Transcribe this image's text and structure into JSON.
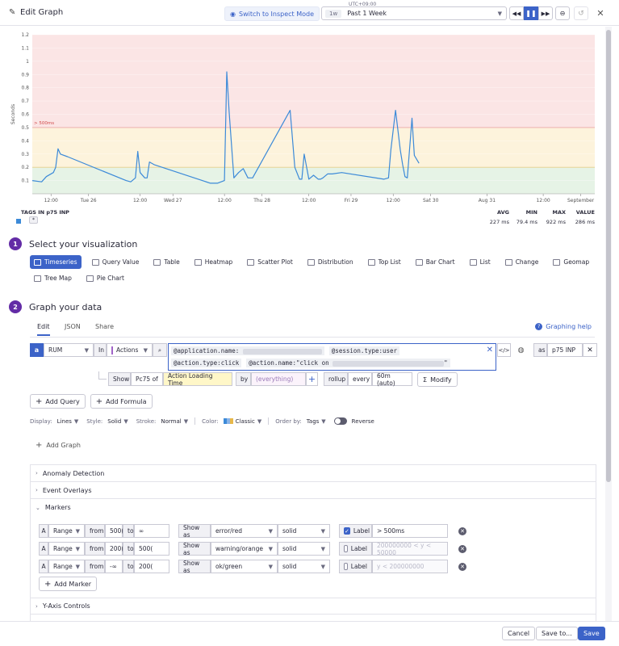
{
  "header": {
    "title": "Edit Graph",
    "inspect_label": "Switch to Inspect Mode",
    "timezone": "UTC+09:00",
    "time_short": "1w",
    "time_label": "Past 1 Week"
  },
  "chart_data": {
    "type": "line",
    "ylabel": "Seconds",
    "ylim": [
      0,
      1.2
    ],
    "y_ticks": [
      "1.2",
      "1.1",
      "1",
      "0.9",
      "0.8",
      "0.7",
      "0.6",
      "0.5",
      "0.4",
      "0.3",
      "0.2",
      "0.1"
    ],
    "x_ticks": [
      "12:00",
      "Tue 26",
      "12:00",
      "Wed 27",
      "12:00",
      "Thu 28",
      "12:00",
      "Fri 29",
      "12:00",
      "Sat 30",
      "Aug 31",
      "12:00",
      "September"
    ],
    "x_tick_pos": [
      0.04,
      0.12,
      0.23,
      0.3,
      0.41,
      0.49,
      0.59,
      0.68,
      0.77,
      0.85,
      0.97,
      1.09,
      1.17
    ],
    "marker_label": "> 500ms",
    "series": [
      {
        "x": [
          0,
          0.02,
          0.03,
          0.045,
          0.05,
          0.055,
          0.06,
          0.075,
          0.2,
          0.21,
          0.22,
          0.225,
          0.23,
          0.24,
          0.245,
          0.25,
          0.26,
          0.38,
          0.395,
          0.41,
          0.415,
          0.42,
          0.43,
          0.44,
          0.45,
          0.46,
          0.47,
          0.55,
          0.56,
          0.57,
          0.575,
          0.58,
          0.59,
          0.6,
          0.61,
          0.615,
          0.62,
          0.63,
          0.64,
          0.66,
          0.75,
          0.76,
          0.765,
          0.775,
          0.785,
          0.79,
          0.795,
          0.8,
          0.81,
          0.815,
          0.825
        ],
        "y": [
          0.1,
          0.09,
          0.13,
          0.16,
          0.2,
          0.34,
          0.3,
          0.28,
          0.1,
          0.09,
          0.12,
          0.32,
          0.16,
          0.12,
          0.12,
          0.24,
          0.22,
          0.08,
          0.08,
          0.1,
          0.92,
          0.62,
          0.12,
          0.16,
          0.19,
          0.12,
          0.12,
          0.63,
          0.2,
          0.11,
          0.11,
          0.3,
          0.11,
          0.14,
          0.11,
          0.11,
          0.12,
          0.15,
          0.15,
          0.16,
          0.11,
          0.12,
          0.33,
          0.63,
          0.33,
          0.22,
          0.13,
          0.12,
          0.57,
          0.29,
          0.23
        ]
      }
    ]
  },
  "legend": {
    "header": "TAGS IN p75 INP",
    "tag": "*",
    "cols": [
      "AVG",
      "MIN",
      "MAX",
      "VALUE"
    ],
    "values": [
      "227 ms",
      "79.4 ms",
      "922 ms",
      "286 ms"
    ]
  },
  "step1": {
    "num": "1",
    "title": "Select your visualization",
    "items": [
      "Timeseries",
      "Query Value",
      "Table",
      "Heatmap",
      "Scatter Plot",
      "Distribution",
      "Top List",
      "Bar Chart",
      "List",
      "Change",
      "Geomap",
      "Tree Map",
      "Pie Chart"
    ]
  },
  "step2": {
    "num": "2",
    "title": "Graph your data",
    "tabs": [
      "Edit",
      "JSON",
      "Share"
    ],
    "help": "Graphing help"
  },
  "query": {
    "letter": "a",
    "source": "RUM",
    "in": "In",
    "dataset": "Actions",
    "filter1a": "@application.name:",
    "filter1b": "@session.type:user",
    "filter2a": "@action.type:click",
    "filter2b": "@action.name:\"click on",
    "as": "as",
    "alias": "p75 INP",
    "show": "Show",
    "agg": "Pc75 of",
    "measure": "Action Loading Time",
    "by": "by",
    "everything": "(everything)",
    "rollup": "rollup",
    "rollup_fn": "every",
    "interval": "60m (auto)",
    "modify": "Modify"
  },
  "actions": {
    "add_query": "Add Query",
    "add_formula": "Add Formula",
    "add_graph": "Add Graph"
  },
  "display": {
    "display_label": "Display:",
    "display_val": "Lines",
    "style_label": "Style:",
    "style_val": "Solid",
    "stroke_label": "Stroke:",
    "stroke_val": "Normal",
    "color_label": "Color:",
    "color_val": "Classic",
    "order_label": "Order by:",
    "order_val": "Tags",
    "reverse": "Reverse"
  },
  "accordion": {
    "anomaly": "Anomaly Detection",
    "events": "Event Overlays",
    "markers": "Markers",
    "yaxis": "Y-Axis Controls"
  },
  "markers": [
    {
      "a": "A",
      "type": "Range",
      "from": "from",
      "from_val": "500(",
      "to": "to",
      "to_val": "∞",
      "show": "Show as",
      "color": "error/red",
      "line": "solid",
      "label": "Label",
      "label_val": "> 500ms",
      "label_placeholder": "",
      "checked": true
    },
    {
      "a": "A",
      "type": "Range",
      "from": "from",
      "from_val": "200(",
      "to": "to",
      "to_val": "500(",
      "show": "Show as",
      "color": "warning/orange",
      "line": "solid",
      "label": "Label",
      "label_val": "",
      "label_placeholder": "200000000 < y < 50000",
      "checked": false
    },
    {
      "a": "A",
      "type": "Range",
      "from": "from",
      "from_val": "-∞",
      "to": "to",
      "to_val": "200(",
      "show": "Show as",
      "color": "ok/green",
      "line": "solid",
      "label": "Label",
      "label_val": "",
      "label_placeholder": "y < 200000000",
      "checked": false
    }
  ],
  "add_marker": "Add Marker",
  "footer": {
    "cancel": "Cancel",
    "save_to": "Save to...",
    "save": "Save"
  }
}
